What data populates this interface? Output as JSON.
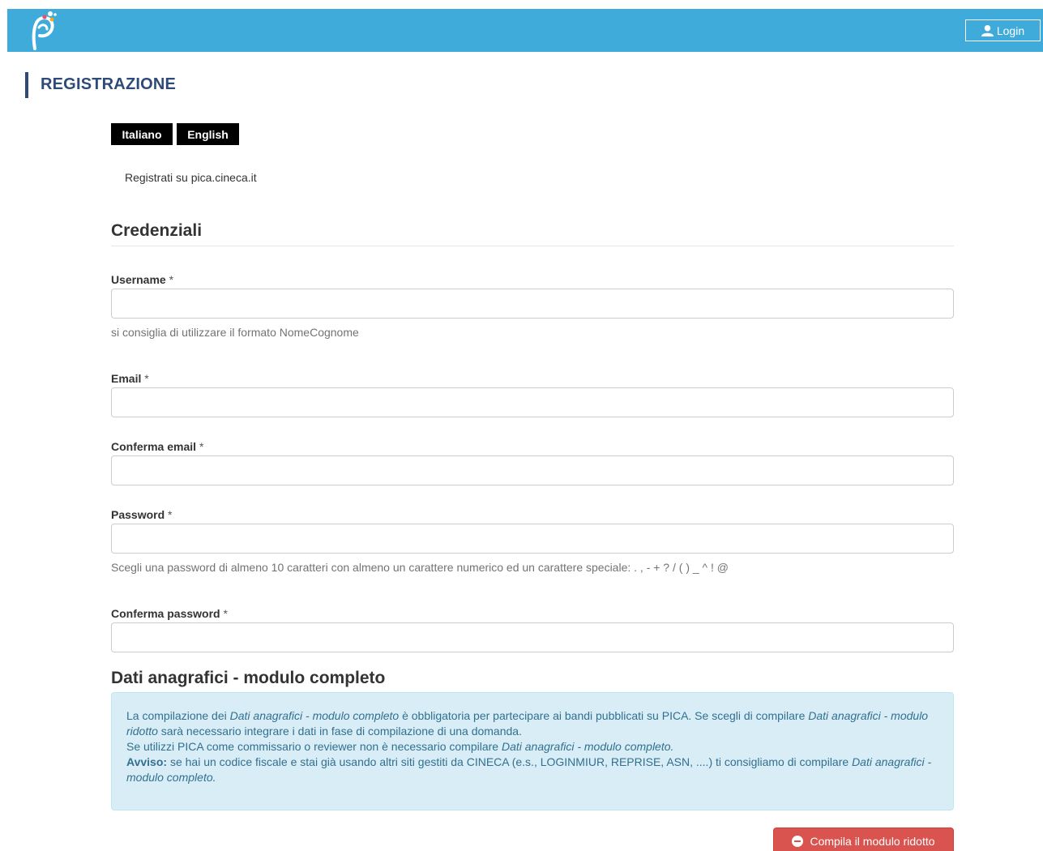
{
  "header": {
    "login_label": "Login",
    "brand_color": "#3fabdb"
  },
  "page": {
    "title": "REGISTRAZIONE",
    "languages": [
      "Italiano",
      "English"
    ],
    "intro": "Registrati su pica.cineca.it"
  },
  "credentials": {
    "heading": "Credenziali",
    "username": {
      "label": "Username",
      "required": "*",
      "value": "",
      "help": "si consiglia di utilizzare il formato NomeCognome"
    },
    "email": {
      "label": "Email",
      "required": "*",
      "value": ""
    },
    "confirm_email": {
      "label": "Conferma email",
      "required": "*",
      "value": ""
    },
    "password": {
      "label": "Password",
      "required": "*",
      "value": "",
      "help": "Scegli una password di almeno 10 caratteri con almeno un carattere numerico ed un carattere speciale: . , - + ? / ( ) _ ^ ! @"
    },
    "confirm_password": {
      "label": "Conferma password",
      "required": "*",
      "value": ""
    }
  },
  "anagrafici": {
    "heading": "Dati anagrafici - modulo completo",
    "info": {
      "p1_a": "La compilazione dei ",
      "p1_em1": "Dati anagrafici - modulo completo",
      "p1_b": " è obbligatoria per partecipare ai bandi pubblicati su PICA. Se scegli di compilare ",
      "p1_em2": "Dati anagrafici - modulo ridotto",
      "p1_c": " sarà necessario integrare i dati in fase di compilazione di una domanda.",
      "p2_a": "Se utilizzi PICA come commissario o reviewer non è necessario compilare ",
      "p2_em": "Dati anagrafici - modulo completo.",
      "p3_bold": "Avviso:",
      "p3_a": " se hai un codice fiscale e stai già usando altri siti gestiti da CINECA (e.s., LOGINMIUR, REPRISE, ASN, ....) ti consigliamo di compilare ",
      "p3_em": "Dati anagrafici - modulo completo."
    },
    "compila_button": "Compila il modulo ridotto",
    "button_color": "#d9534f"
  }
}
